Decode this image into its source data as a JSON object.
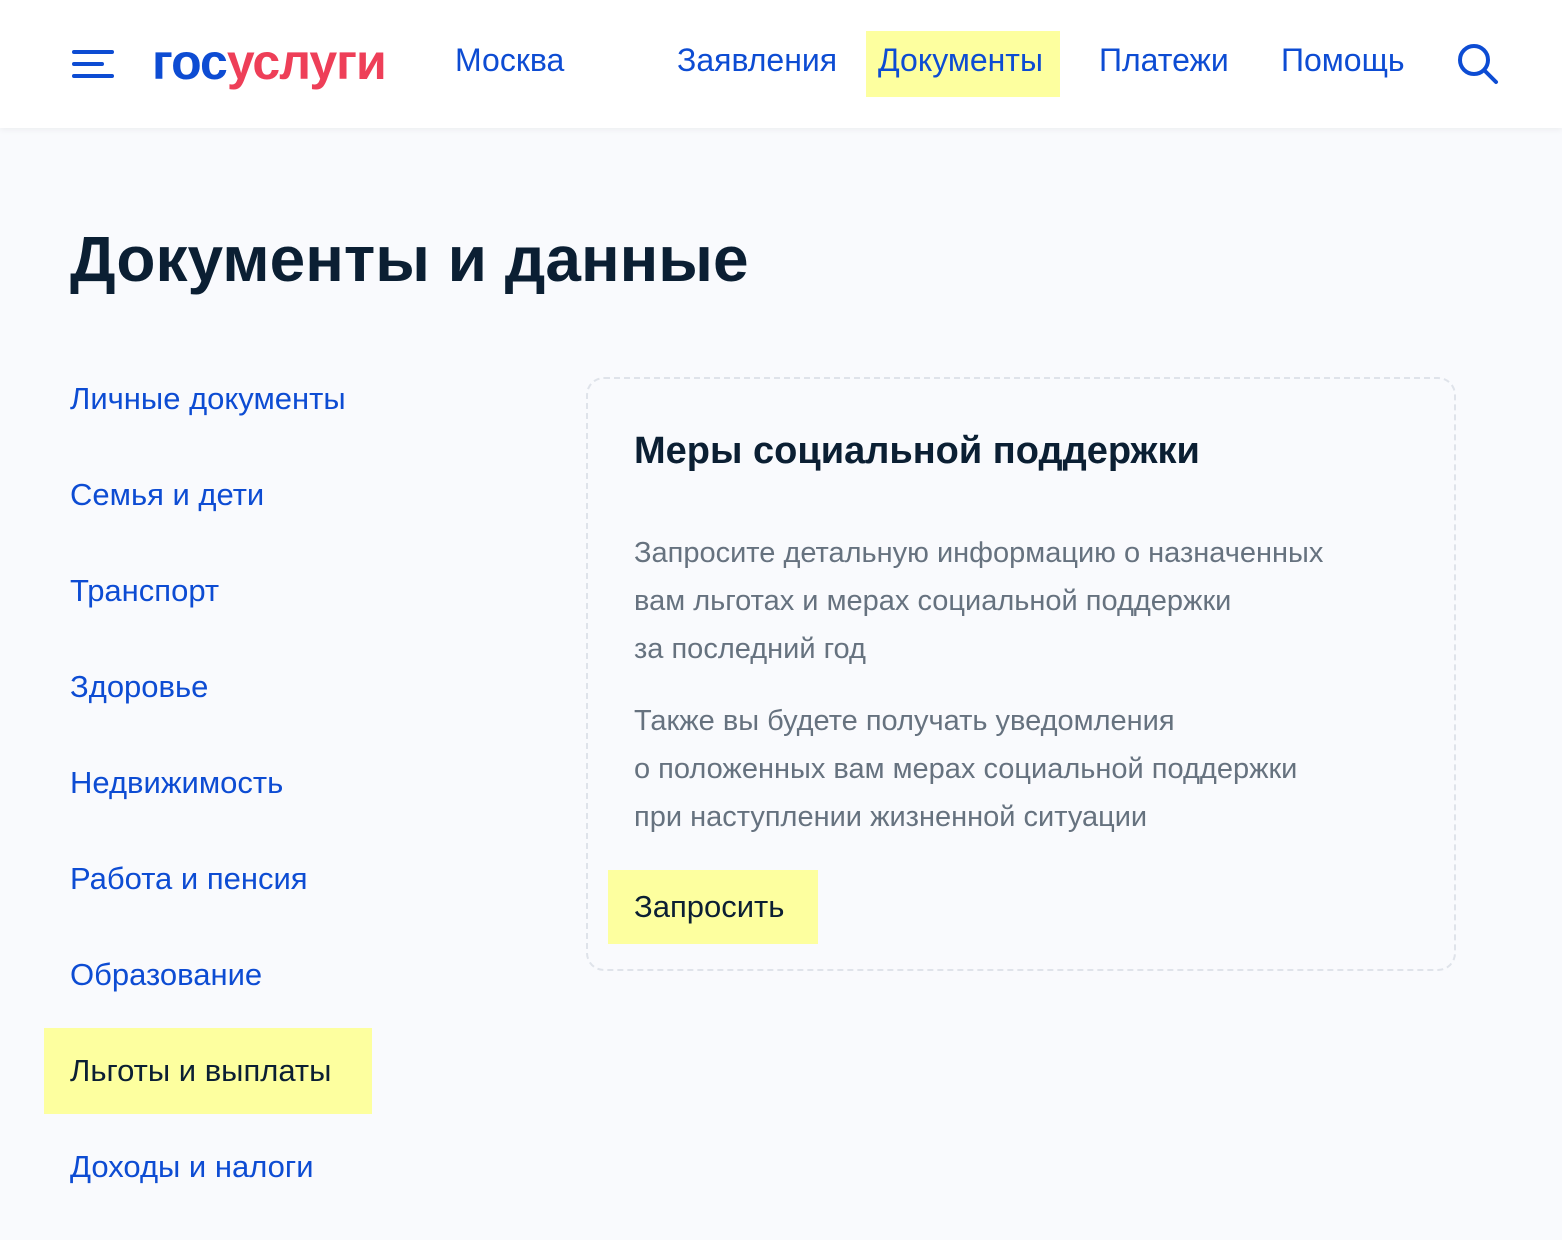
{
  "header": {
    "logo": {
      "part1": "гос",
      "part2": "услуги"
    },
    "city": "Москва",
    "nav": [
      {
        "label": "Заявления"
      },
      {
        "label": "Документы",
        "highlighted": true
      },
      {
        "label": "Платежи"
      },
      {
        "label": "Помощь"
      }
    ],
    "menu_icon": "hamburger-menu-icon",
    "search_icon": "search-icon"
  },
  "main": {
    "title": "Документы и данные"
  },
  "sidebar": {
    "items": [
      {
        "label": "Личные документы"
      },
      {
        "label": "Семья и дети"
      },
      {
        "label": "Транспорт"
      },
      {
        "label": "Здоровье"
      },
      {
        "label": "Недвижимость"
      },
      {
        "label": "Работа и пенсия"
      },
      {
        "label": "Образование"
      },
      {
        "label": "Льготы и выплаты",
        "highlighted": true
      },
      {
        "label": "Доходы и налоги"
      }
    ]
  },
  "card": {
    "title": "Меры социальной поддержки",
    "paragraph1": [
      "Запросите детальную информацию о назначенных",
      "вам льготах и мерах социальной поддержки",
      "за последний год"
    ],
    "paragraph2": [
      "Также вы будете получать уведомления",
      "о положенных вам мерах социальной поддержки",
      "при наступлении жизненной ситуации"
    ],
    "button_label": "Запросить"
  },
  "colors": {
    "brand_blue": "#0d4cd3",
    "brand_red": "#ee3f58",
    "highlight": "#fdff9f",
    "text_dark": "#0b1f33",
    "text_muted": "#66727f",
    "page_bg": "#f9fafd"
  }
}
